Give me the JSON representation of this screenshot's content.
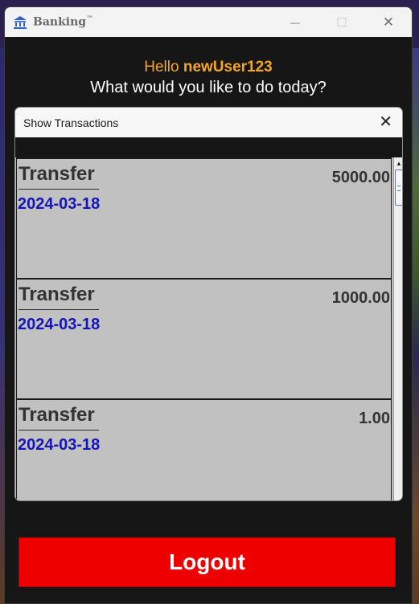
{
  "window": {
    "title": "Banking",
    "trademark": "™",
    "minimize_glyph": "—",
    "maximize_glyph": "☐",
    "close_glyph": "✕"
  },
  "header": {
    "greeting_prefix": "Hello",
    "username": "newUser123",
    "question": "What would you like to do today?"
  },
  "dialog": {
    "title": "Show Transactions",
    "close_glyph": "✕"
  },
  "transactions": [
    {
      "type": "Transfer",
      "date": "2024-03-18",
      "amount": "5000.00"
    },
    {
      "type": "Transfer",
      "date": "2024-03-18",
      "amount": "1000.00"
    },
    {
      "type": "Transfer",
      "date": "2024-03-18",
      "amount": "1.00"
    }
  ],
  "actions": {
    "logout_label": "Logout"
  },
  "colors": {
    "greeting": "#f5a623",
    "date": "#1616b8",
    "logout": "#ee0000"
  },
  "icons": {
    "app": "bank-building-icon",
    "scroll_up": "scroll-up-arrow-icon"
  }
}
